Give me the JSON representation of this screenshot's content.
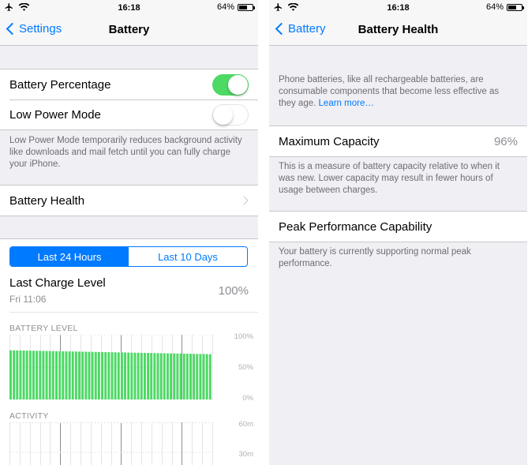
{
  "left": {
    "status": {
      "time": "16:18",
      "battery_percent": "64%",
      "battery_fill": 0.64
    },
    "nav": {
      "back_label": "Settings",
      "title": "Battery"
    },
    "toggles": [
      {
        "label": "Battery Percentage",
        "on": true
      },
      {
        "label": "Low Power Mode",
        "on": false
      }
    ],
    "low_power_footer": "Low Power Mode temporarily reduces background activity like downloads and mail fetch until you can fully charge your iPhone.",
    "battery_health_label": "Battery Health",
    "tabs": [
      {
        "label": "Last 24 Hours",
        "active": true
      },
      {
        "label": "Last 10 Days",
        "active": false
      }
    ],
    "last_charge": {
      "title": "Last Charge Level",
      "time": "Fri 11:06",
      "value": "100%"
    },
    "battery_level_label": "BATTERY LEVEL",
    "battery_axis": [
      "100%",
      "50%",
      "0%"
    ],
    "activity_label": "ACTIVITY",
    "activity_axis": [
      "60m",
      "30m"
    ],
    "colors": {
      "accent": "#007aff",
      "toggle_on": "#4cd964",
      "bar": "#4cd964"
    },
    "chart_data": {
      "type": "bar",
      "ylim": [
        0,
        100
      ],
      "bar_count": 62,
      "level_start": 76,
      "level_end": 70
    }
  },
  "right": {
    "status": {
      "time": "16:18",
      "battery_percent": "64%",
      "battery_fill": 0.64
    },
    "nav": {
      "back_label": "Battery",
      "title": "Battery Health"
    },
    "intro": "Phone batteries, like all rechargeable batteries, are consumable components that become less effective as they age.",
    "learn_more": "Learn more…",
    "max_capacity": {
      "label": "Maximum Capacity",
      "value": "96%"
    },
    "capacity_footer": "This is a measure of battery capacity relative to when it was new. Lower capacity may result in fewer hours of usage between charges.",
    "peak_label": "Peak Performance Capability",
    "peak_footer": "Your battery is currently supporting normal peak performance."
  },
  "icons": [
    "airplane-icon",
    "wifi-icon",
    "battery-icon",
    "chevron-left-icon",
    "chevron-right-icon"
  ]
}
